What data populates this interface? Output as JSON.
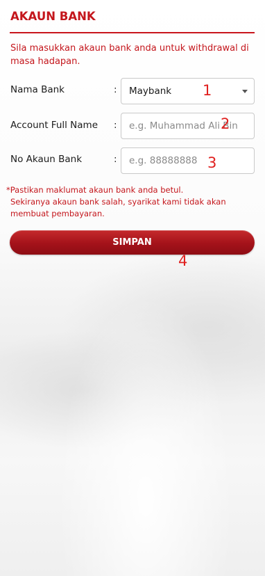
{
  "header": {
    "title": "AKAUN BANK"
  },
  "instruction": "Sila masukkan akaun bank anda untuk withdrawal di masa hadapan.",
  "form": {
    "bank_name": {
      "label": "Nama Bank",
      "colon": ":",
      "selected": "Maybank",
      "marker": "1"
    },
    "full_name": {
      "label": "Account Full Name",
      "colon": ":",
      "placeholder": "e.g. Muhammad Ali Bin",
      "marker": "2"
    },
    "account_no": {
      "label": "No Akaun Bank",
      "colon": ":",
      "placeholder": "e.g. 88888888",
      "marker": "3"
    }
  },
  "notice": {
    "line1": "*Pastikan maklumat akaun bank anda betul.",
    "line2": "Sekiranya akaun bank salah, syarikat kami tidak akan",
    "line3": "membuat pembayaran."
  },
  "save_button": {
    "label": "SIMPAN",
    "marker": "4"
  },
  "colors": {
    "accent": "#c4161c",
    "marker": "#e0201f"
  },
  "icons": {
    "dropdown": "caret-down-icon"
  }
}
